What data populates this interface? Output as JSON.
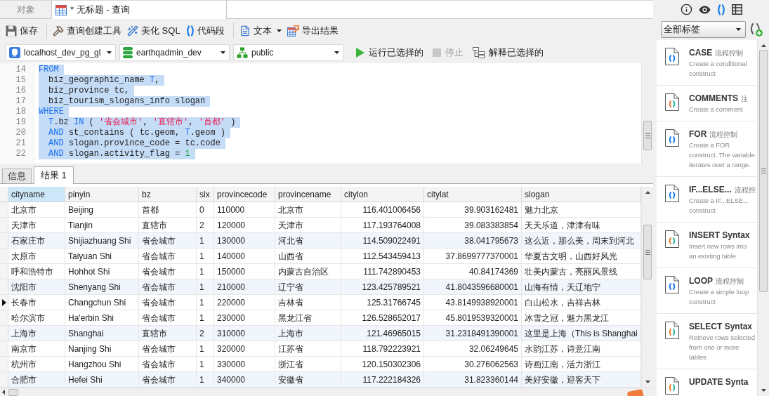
{
  "tabs": [
    {
      "label": "对象",
      "selected": false
    },
    {
      "label": "* 无标题 - 查询",
      "selected": true,
      "kind": "query"
    }
  ],
  "side_tabs": [
    {
      "kind": "info",
      "selected": false
    },
    {
      "kind": "preview",
      "selected": false
    },
    {
      "kind": "snippets",
      "selected": true
    },
    {
      "kind": "layout",
      "selected": false
    }
  ],
  "toolbar": [
    [
      {
        "kind": "save",
        "label": "保存",
        "dropdown": false
      }
    ],
    [
      {
        "kind": "query_builder",
        "label": "查询创建工具",
        "dropdown": false
      },
      {
        "kind": "beautify",
        "label": "美化 SQL",
        "dropdown": false
      },
      {
        "kind": "snippet",
        "label": "代码段",
        "dropdown": false
      }
    ],
    [
      {
        "kind": "text",
        "label": "文本",
        "dropdown": true
      },
      {
        "kind": "export",
        "label": "导出结果",
        "dropdown": false
      }
    ]
  ],
  "connection_bar": {
    "connection": "localhost_dev_pg_gl",
    "database": "earthqadmin_dev",
    "schema": "public"
  },
  "actions": [
    {
      "kind": "run",
      "label": "运行已选择的",
      "disabled": false
    },
    {
      "kind": "stop",
      "label": "停止",
      "disabled": true
    },
    {
      "kind": "explain",
      "label": "解释已选择的",
      "disabled": false
    }
  ],
  "editor": {
    "lines": [
      {
        "number": "14",
        "selected": true,
        "indented": false,
        "tokens": [
          {
            "text": "FROM",
            "kind": "keyword"
          }
        ]
      },
      {
        "number": "15",
        "selected": true,
        "indented": true,
        "tokens": [
          {
            "text": "biz_geographic_name ",
            "kind": "plain"
          },
          {
            "text": "T",
            "kind": "alias"
          },
          {
            "text": ",",
            "kind": "plain"
          }
        ]
      },
      {
        "number": "16",
        "selected": true,
        "indented": true,
        "tokens": [
          {
            "text": "biz_province tc,",
            "kind": "plain"
          }
        ]
      },
      {
        "number": "17",
        "selected": true,
        "indented": true,
        "tokens": [
          {
            "text": "biz_tourism_slogans_info slogan",
            "kind": "plain"
          }
        ]
      },
      {
        "number": "18",
        "selected": true,
        "indented": false,
        "tokens": [
          {
            "text": "WHERE",
            "kind": "keyword"
          }
        ]
      },
      {
        "number": "19",
        "selected": true,
        "indented": true,
        "tokens": [
          {
            "text": "T",
            "kind": "alias"
          },
          {
            "text": ".bz ",
            "kind": "plain"
          },
          {
            "text": "IN",
            "kind": "keyword"
          },
          {
            "text": " ( ",
            "kind": "plain"
          },
          {
            "text": "'省会城市'",
            "kind": "string"
          },
          {
            "text": ", ",
            "kind": "plain"
          },
          {
            "text": "'直辖市'",
            "kind": "string"
          },
          {
            "text": ", ",
            "kind": "plain"
          },
          {
            "text": "'首都'",
            "kind": "string"
          },
          {
            "text": " )",
            "kind": "plain"
          }
        ]
      },
      {
        "number": "20",
        "selected": true,
        "indented": true,
        "tokens": [
          {
            "text": "AND",
            "kind": "keyword"
          },
          {
            "text": " st_contains ( tc.geom, ",
            "kind": "plain"
          },
          {
            "text": "T",
            "kind": "alias"
          },
          {
            "text": ".geom )",
            "kind": "plain"
          }
        ]
      },
      {
        "number": "21",
        "selected": true,
        "indented": true,
        "tokens": [
          {
            "text": "AND",
            "kind": "keyword"
          },
          {
            "text": " slogan.province_code = tc.code",
            "kind": "plain"
          }
        ]
      },
      {
        "number": "22",
        "selected": true,
        "indented": true,
        "tokens": [
          {
            "text": "AND",
            "kind": "keyword"
          },
          {
            "text": " slogan.activity_flag = ",
            "kind": "plain"
          },
          {
            "text": "1",
            "kind": "number"
          }
        ]
      }
    ]
  },
  "result_tabs": [
    {
      "label": "信息",
      "selected": false
    },
    {
      "label": "结果 1",
      "selected": true
    }
  ],
  "grid": {
    "columns": [
      {
        "label": "cityname",
        "selected": true,
        "right_aligned": false
      },
      {
        "label": "pinyin",
        "selected": false,
        "right_aligned": false
      },
      {
        "label": "bz",
        "selected": false,
        "right_aligned": false
      },
      {
        "label": "slx",
        "selected": false,
        "right_aligned": false
      },
      {
        "label": "provincecode",
        "selected": false,
        "right_aligned": false
      },
      {
        "label": "provincename",
        "selected": false,
        "right_aligned": false
      },
      {
        "label": "citylon",
        "selected": false,
        "right_aligned": true
      },
      {
        "label": "citylat",
        "selected": false,
        "right_aligned": true
      },
      {
        "label": "slogan",
        "selected": false,
        "right_aligned": false
      }
    ],
    "rows": [
      {
        "selected": false,
        "cells": [
          "北京市",
          "Beijing",
          "首都",
          "0",
          "110000",
          "北京市",
          "116.401006456",
          "39.903162481",
          "魅力北京"
        ]
      },
      {
        "selected": false,
        "cells": [
          "天津市",
          "Tianjin",
          "直辖市",
          "2",
          "120000",
          "天津市",
          "117.193764008",
          "39.083383854",
          "天天乐道，津津有味"
        ]
      },
      {
        "selected": false,
        "cells": [
          "石家庄市",
          "Shijiazhuang Shi",
          "省会城市",
          "1",
          "130000",
          "河北省",
          "114.509022491",
          "38.041795673",
          "这么近，那么美，周末到河北"
        ]
      },
      {
        "selected": false,
        "cells": [
          "太原市",
          "Taiyuan Shi",
          "省会城市",
          "1",
          "140000",
          "山西省",
          "112.543459413",
          "37.8699777370001",
          "华夏古文明，山西好风光"
        ]
      },
      {
        "selected": false,
        "cells": [
          "呼和浩特市",
          "Hohhot Shi",
          "省会城市",
          "1",
          "150000",
          "内蒙古自治区",
          "111.742890453",
          "40.84174369",
          "壮美内蒙古，亮丽风景线"
        ]
      },
      {
        "selected": false,
        "cells": [
          "沈阳市",
          "Shenyang Shi",
          "省会城市",
          "1",
          "210000",
          "辽宁省",
          "123.425789521",
          "41.8043596680001",
          "山海有情，天辽地宁"
        ]
      },
      {
        "selected": true,
        "cells": [
          "长春市",
          "Changchun Shi",
          "省会城市",
          "1",
          "220000",
          "吉林省",
          "125.31766745",
          "43.8149938920001",
          "白山松水，吉祥吉林"
        ]
      },
      {
        "selected": false,
        "cells": [
          "哈尔滨市",
          "Ha'erbin Shi",
          "省会城市",
          "1",
          "230000",
          "黑龙江省",
          "126.528652017",
          "45.8019539320001",
          "冰雪之冠，魅力黑龙江"
        ]
      },
      {
        "selected": false,
        "cells": [
          "上海市",
          "Shanghai",
          "直辖市",
          "2",
          "310000",
          "上海市",
          "121.46965015",
          "31.2318491390001",
          "这里是上海（This is Shanghai"
        ]
      },
      {
        "selected": false,
        "cells": [
          "南京市",
          "Nanjing Shi",
          "省会城市",
          "1",
          "320000",
          "江苏省",
          "118.792223921",
          "32.06249645",
          "水韵江苏，诗意江南"
        ]
      },
      {
        "selected": false,
        "cells": [
          "杭州市",
          "Hangzhou Shi",
          "省会城市",
          "1",
          "330000",
          "浙江省",
          "120.150302306",
          "30.276062563",
          "诗画江南，活力浙江"
        ]
      },
      {
        "selected": false,
        "cells": [
          "合肥市",
          "Hefei Shi",
          "省会城市",
          "1",
          "340000",
          "安徽省",
          "117.222184326",
          "31.823360144",
          "美好安徽，迎客天下"
        ]
      }
    ]
  },
  "snippets": {
    "filter": "全部标签",
    "items": [
      {
        "kind": "flow",
        "title": "CASE",
        "tag": "流程控制",
        "description": "Create a conditional construct"
      },
      {
        "kind": "syntax",
        "title": "COMMENTS",
        "tag": "注",
        "description": "Create a comment"
      },
      {
        "kind": "flow",
        "title": "FOR",
        "tag": "流程控制",
        "description": "Create a FOR construct. The variable iterates over a range."
      },
      {
        "kind": "flow",
        "title": "IF...ELSE...",
        "tag": "流程控",
        "description": "Create a IF...ELSE... construct"
      },
      {
        "kind": "syntax",
        "title": "INSERT Syntax",
        "description": "Insert new rows into an existing table"
      },
      {
        "kind": "flow",
        "title": "LOOP",
        "tag": "流程控制",
        "description": "Create a simple loop construct"
      },
      {
        "kind": "syntax",
        "title": "SELECT Syntax",
        "description": "Retrieve rows selected from one or more tables"
      },
      {
        "kind": "syntax",
        "title": "UPDATE Synta"
      }
    ]
  }
}
